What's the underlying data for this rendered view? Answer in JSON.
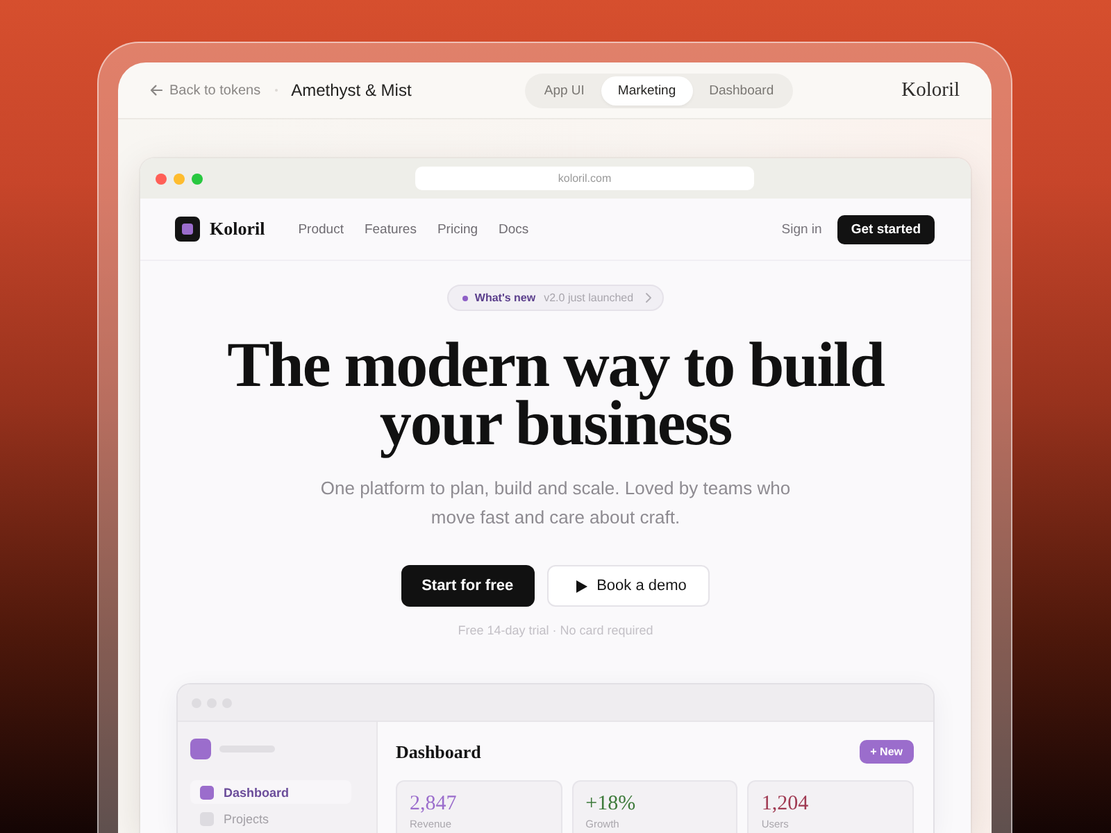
{
  "header": {
    "back_link": "Back to tokens",
    "title": "Amethyst & Mist",
    "tabs": [
      {
        "label": "App UI",
        "selected": false
      },
      {
        "label": "Marketing",
        "selected": true
      },
      {
        "label": "Dashboard",
        "selected": false
      }
    ],
    "brand": "Koloril"
  },
  "browser": {
    "url": "koloril.com"
  },
  "site": {
    "nav": {
      "brand": "Koloril",
      "links": [
        "Product",
        "Features",
        "Pricing",
        "Docs"
      ],
      "sign_in": "Sign in",
      "cta": "Get started"
    },
    "announcement": {
      "tag": "What's new",
      "text": "v2.0 just launched"
    },
    "hero": {
      "headline": "The modern way to build your business",
      "subtitle": "One platform to plan, build and scale. Loved by teams who move fast and care about craft.",
      "buttons": [
        {
          "label": "Start for free",
          "kind": "primary"
        },
        {
          "label": "Book a demo",
          "kind": "secondary"
        }
      ],
      "note": "Free 14-day trial · No card required"
    },
    "preview": {
      "sidebar_items": [
        {
          "label": "Dashboard",
          "selected": true
        },
        {
          "label": "Projects",
          "selected": false
        }
      ],
      "title": "Dashboard",
      "new_button": "+ New",
      "stats": [
        {
          "value": "2,847",
          "label": "Revenue",
          "color": "#9b6dcc"
        },
        {
          "value": "+18%",
          "label": "Growth",
          "color": "#3d7a3a"
        },
        {
          "value": "1,204",
          "label": "Users",
          "color": "#a03a52"
        }
      ]
    }
  }
}
